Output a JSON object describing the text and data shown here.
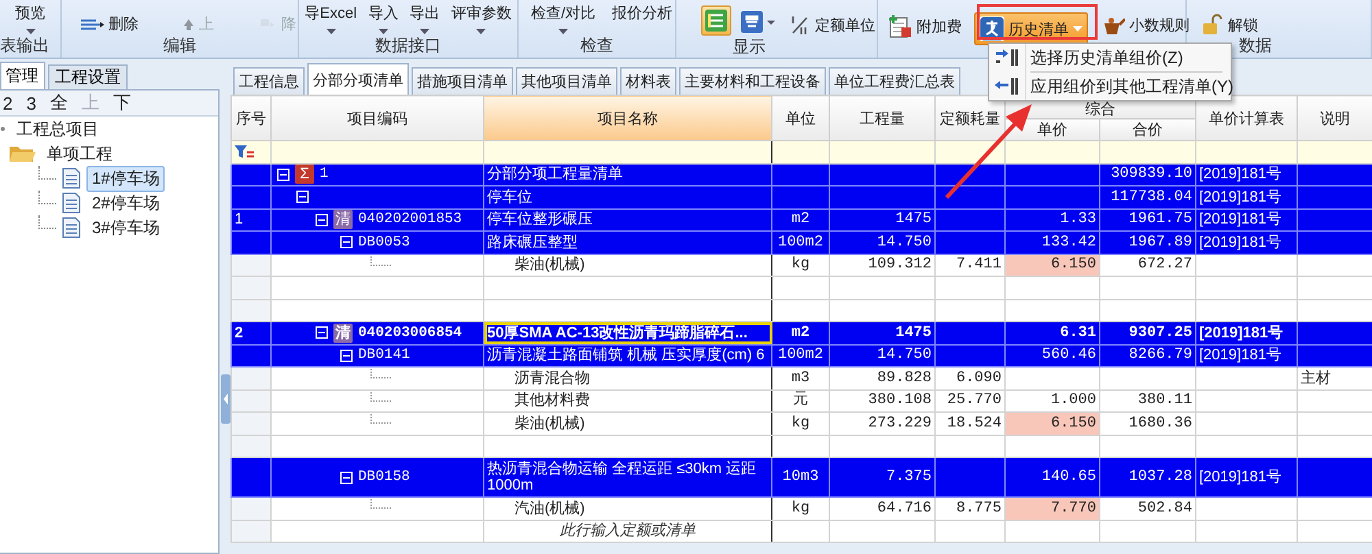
{
  "ribbon": {
    "groups": [
      {
        "label": "表输出",
        "buttons": [
          {
            "kind": "dropdown",
            "label": "预览",
            "disabled": false
          }
        ]
      },
      {
        "label": "编辑",
        "buttons": [
          {
            "kind": "delete",
            "label": "删除",
            "disabled": false
          },
          {
            "kind": "up",
            "label": "上",
            "disabled": true
          },
          {
            "kind": "down",
            "label": "降",
            "disabled": true
          }
        ]
      },
      {
        "label": "数据接口",
        "buttons": [
          {
            "kind": "dropdown",
            "label": "导Excel",
            "disabled": false
          },
          {
            "kind": "dropdown",
            "label": "导入",
            "disabled": false
          },
          {
            "kind": "dropdown",
            "label": "导出",
            "disabled": false
          },
          {
            "kind": "dropdown",
            "label": "评审参数",
            "disabled": false
          }
        ]
      },
      {
        "label": "检查",
        "buttons": [
          {
            "kind": "dropdown",
            "label": "检查/对比",
            "disabled": false
          },
          {
            "kind": "plain",
            "label": "报价分析",
            "disabled": false
          }
        ]
      },
      {
        "label": "显示",
        "buttons": [
          {
            "kind": "view",
            "active": true
          },
          {
            "kind": "hide",
            "active": false
          },
          {
            "kind": "unit",
            "label": "定额单位",
            "active": false
          }
        ]
      },
      {
        "buttons": [
          {
            "kind": "surcharge",
            "label": "附加费",
            "active": false
          },
          {
            "kind": "history",
            "label": "历史清单",
            "active": true
          },
          {
            "kind": "decimal",
            "label": "小数规则",
            "active": false
          }
        ]
      },
      {
        "label": "数据",
        "buttons": [
          {
            "kind": "unlock",
            "label": "解锁",
            "disabled": false
          }
        ]
      }
    ]
  },
  "history_menu": {
    "items": [
      {
        "kind": "select",
        "label": "选择历史清单组价(Z)"
      },
      {
        "kind": "apply",
        "label": "应用组价到其他工程清单(Y)"
      }
    ]
  },
  "left_panel": {
    "tabs": [
      {
        "label": "管理",
        "selected": true
      },
      {
        "label": "工程设置",
        "selected": false
      }
    ],
    "toolbar": [
      {
        "label": "2",
        "disabled": false
      },
      {
        "label": "3",
        "disabled": false
      },
      {
        "label": "全",
        "disabled": false
      },
      {
        "label": "上",
        "disabled": true
      },
      {
        "label": "下",
        "disabled": false
      }
    ],
    "tree": [
      {
        "label": "工程总项目",
        "kind": "root",
        "selected": false,
        "children": [
          {
            "label": "单项工程",
            "kind": "folder",
            "selected": false,
            "children": [
              {
                "label": "1#停车场",
                "kind": "file",
                "selected": true
              },
              {
                "label": "2#停车场",
                "kind": "file",
                "selected": false
              },
              {
                "label": "3#停车场",
                "kind": "file",
                "selected": false
              }
            ]
          }
        ]
      }
    ]
  },
  "tabs": [
    {
      "label": "工程信息",
      "selected": false
    },
    {
      "label": "分部分项清单",
      "selected": true
    },
    {
      "label": "措施项目清单",
      "selected": false
    },
    {
      "label": "其他项目清单",
      "selected": false
    },
    {
      "label": "材料表",
      "selected": false
    },
    {
      "label": "主要材料和工程设备",
      "selected": false
    },
    {
      "label": "单位工程费汇总表",
      "selected": false
    }
  ],
  "table": {
    "columns": [
      {
        "label": "序号",
        "selected": false
      },
      {
        "label": "项目编码",
        "selected": false
      },
      {
        "label": "项目名称",
        "selected": true
      },
      {
        "label": "单位",
        "selected": false
      },
      {
        "label": "工程量",
        "selected": false
      },
      {
        "label": "定额耗量",
        "selected": false
      },
      {
        "label": "综合",
        "selected": false,
        "children": [
          {
            "label": "单价",
            "selected": false
          },
          {
            "label": "合价",
            "selected": false
          }
        ]
      },
      {
        "label": "单价计算表",
        "selected": false
      },
      {
        "label": "说明",
        "selected": false
      }
    ],
    "rows": [
      {
        "kind": "group",
        "badge": "Σ",
        "code": "1",
        "name": "分部分项工程量清单",
        "total": "309839.10",
        "calc_table": "[2019]181号",
        "selected": false,
        "price_highlighted": false
      },
      {
        "kind": "section",
        "name": "停车位",
        "total": "117738.04",
        "calc_table": "[2019]181号",
        "selected": false,
        "price_highlighted": false
      },
      {
        "kind": "item",
        "index": "1",
        "badge": "清",
        "code": "040202001853",
        "name": "停车位整形碾压",
        "unit": "m2",
        "quantity": "1475",
        "unit_price": "1.33",
        "total": "1961.75",
        "calc_table": "[2019]181号",
        "selected": false,
        "price_highlighted": false
      },
      {
        "kind": "quota",
        "code": "DB0053",
        "name": "路床碾压整型",
        "unit": "100m2",
        "quantity": "14.750",
        "unit_price": "133.42",
        "total": "1967.89",
        "calc_table": "[2019]181号",
        "selected": false,
        "price_highlighted": false
      },
      {
        "kind": "material",
        "name": "柴油(机械)",
        "unit": "kg",
        "quantity": "109.312",
        "consumption": "7.411",
        "unit_price": "6.150",
        "total": "672.27",
        "selected": false,
        "price_highlighted": true
      },
      {
        "kind": "blank",
        "selected": false,
        "price_highlighted": false
      },
      {
        "kind": "blank",
        "selected": false,
        "price_highlighted": false
      },
      {
        "kind": "item",
        "index": "2",
        "badge": "清",
        "code": "040203006854",
        "name": "50厚SMA AC-13改性沥青玛蹄脂碎石...",
        "unit": "m2",
        "quantity": "1475",
        "unit_price": "6.31",
        "total": "9307.25",
        "calc_table": "[2019]181号",
        "selected": true,
        "price_highlighted": false
      },
      {
        "kind": "quota",
        "code": "DB0141",
        "name": "沥青混凝土路面铺筑 机械 压实厚度(cm) 6",
        "unit": "100m2",
        "quantity": "14.750",
        "unit_price": "560.46",
        "total": "8266.79",
        "calc_table": "[2019]181号",
        "selected": false,
        "price_highlighted": false
      },
      {
        "kind": "material",
        "name": "沥青混合物",
        "unit": "m3",
        "quantity": "89.828",
        "consumption": "6.090",
        "note": "主材",
        "selected": false,
        "price_highlighted": false
      },
      {
        "kind": "material",
        "name": "其他材料费",
        "unit": "元",
        "quantity": "380.108",
        "consumption": "25.770",
        "unit_price": "1.000",
        "total": "380.11",
        "selected": false,
        "price_highlighted": false
      },
      {
        "kind": "material",
        "name": "柴油(机械)",
        "unit": "kg",
        "quantity": "273.229",
        "consumption": "18.524",
        "unit_price": "6.150",
        "total": "1680.36",
        "selected": false,
        "price_highlighted": true
      },
      {
        "kind": "blank",
        "selected": false,
        "price_highlighted": false
      },
      {
        "kind": "quota",
        "code": "DB0158",
        "name": "热沥青混合物运输 全程运距 ≤30km 运距1000m",
        "unit": "10m3",
        "quantity": "7.375",
        "unit_price": "140.65",
        "total": "1037.28",
        "calc_table": "[2019]181号",
        "selected": false,
        "price_highlighted": false
      },
      {
        "kind": "material",
        "name": "汽油(机械)",
        "unit": "kg",
        "quantity": "64.716",
        "consumption": "8.775",
        "unit_price": "7.770",
        "total": "502.84",
        "selected": false,
        "price_highlighted": true
      },
      {
        "kind": "input",
        "name": "此行输入定额或清单",
        "selected": false,
        "price_highlighted": false
      }
    ]
  }
}
